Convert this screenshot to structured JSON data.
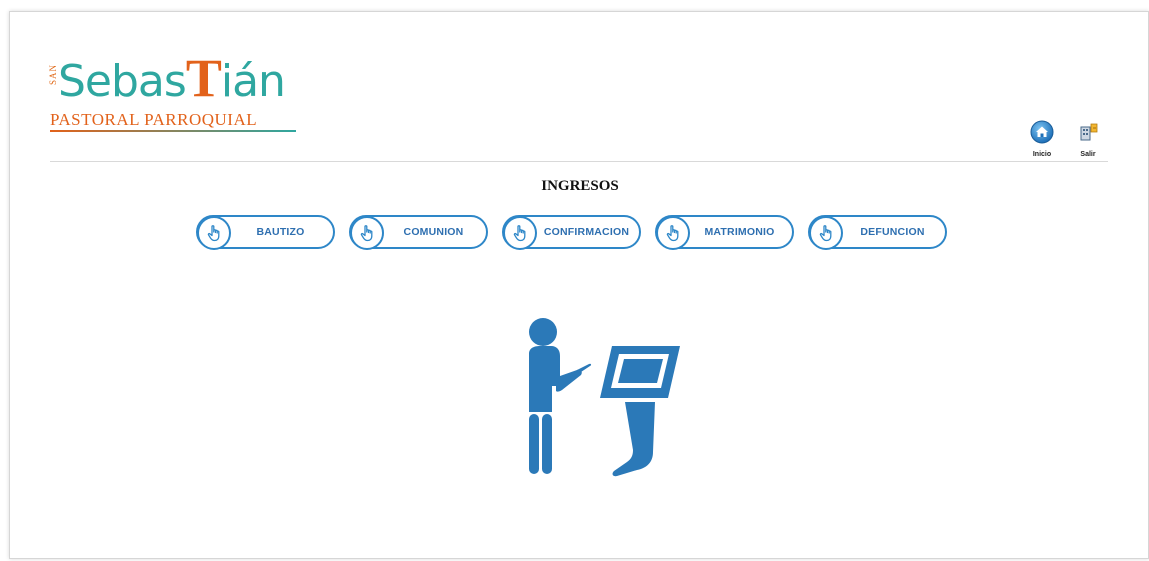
{
  "logo": {
    "name_part1": "Sebas",
    "name_accent": "T",
    "name_part2": "ián",
    "vertical_text": "SAN",
    "subtitle": "PASTORAL PARROQUIAL"
  },
  "header_icons": [
    {
      "icon": "home-icon",
      "label": "Inicio"
    },
    {
      "icon": "exit-icon",
      "label": "Salir"
    }
  ],
  "main": {
    "heading": "INGRESOS",
    "buttons": [
      {
        "label": "BAUTIZO",
        "icon": "hand-pointer-icon"
      },
      {
        "label": "COMUNION",
        "icon": "hand-pointer-icon"
      },
      {
        "label": "CONFIRMACION",
        "icon": "hand-pointer-icon"
      },
      {
        "label": "MATRIMONIO",
        "icon": "hand-pointer-icon"
      },
      {
        "label": "DEFUNCION",
        "icon": "hand-pointer-icon"
      }
    ],
    "illustration": "person-at-kiosk-icon"
  },
  "colors": {
    "accent_blue": "#2e87c8",
    "logo_teal": "#2fa7a0",
    "logo_orange": "#e2621b"
  }
}
